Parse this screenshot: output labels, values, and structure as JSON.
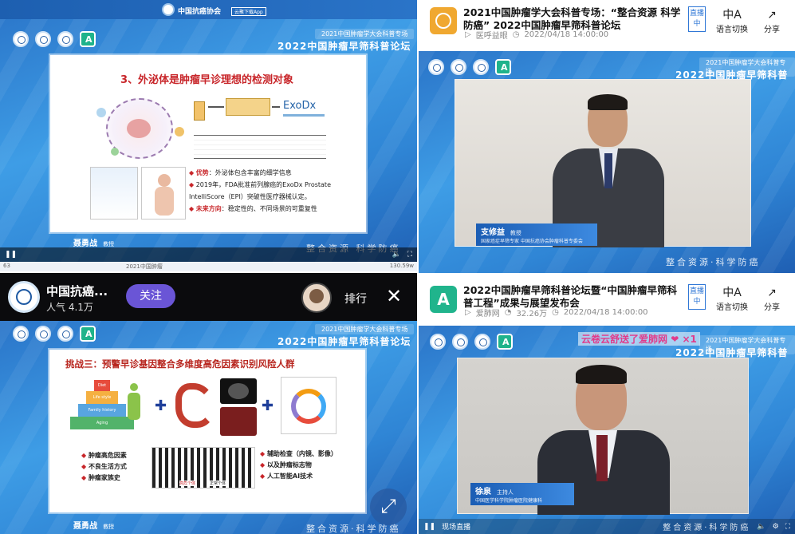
{
  "q1": {
    "header_logo_text": "中国抗癌协会",
    "header_tag": "云聚下载App",
    "forum_sub": "2021中国肿瘤学大会科普专场",
    "forum_title": "2022中国肿瘤早筛科普论坛",
    "slide_title": "3、外泌体是肿瘤早诊理想的检测对象",
    "exodx_label": "ExoDx",
    "bullets": [
      {
        "label": "优势",
        "text": "外泌体包含丰富的细学信息"
      },
      {
        "label": "",
        "text": "2019年，FDA批准前列腺癌的ExoDx Prostate IntelliScore（EPI）突破性医疗器械认定。"
      },
      {
        "label": "未来方向",
        "text": "稳定性的、不同场景的可重复性"
      }
    ],
    "speaker_name": "聂勇战",
    "speaker_role": "教授",
    "slogan": "整合资源  科学防癌",
    "bottom_left": "63",
    "bottom_mid": "2021中国肿瘤",
    "bottom_right": "130.59w"
  },
  "q2": {
    "title": "2021中国肿瘤学大会科普专场：“整合资源 科学防癌” 2022中国肿瘤早筛科普论坛",
    "channel": "医呼益眼",
    "date": "2022/04/18 14:00:00",
    "live_label": "直播中",
    "lang_label": "语言切换",
    "share_label": "分享",
    "forum_sub": "2021中国肿瘤学大会科普专场",
    "forum_title": "2022中国肿瘤早筛科普论坛",
    "speaker_name": "支修益",
    "speaker_role": "教授",
    "speaker_org": "国家癌症早筛专家 中国抗癌协会肿瘤科普专委会",
    "slogan": "整合资源·科学防癌"
  },
  "q3": {
    "channel_name": "中国抗癌...",
    "popularity": "人气 4.1万",
    "follow_label": "关注",
    "rank_label": "排行",
    "forum_sub": "2021中国肿瘤学大会科普专场",
    "forum_title": "2022中国肿瘤早筛科普论坛",
    "slide_title": "挑战三：预警早诊基因整合多维度高危因素识别风险人群",
    "pyramid": [
      "Diet",
      "Life style",
      "Family history",
      "Aging"
    ],
    "left_list": [
      "肿瘤高危因素",
      "不良生活方式",
      "肿瘤家族史"
    ],
    "right_list": [
      "辅助检查（内镜、影像）",
      "以及肿瘤标志物",
      "人工智能AI技术"
    ],
    "crowd_labels": [
      "高危个体",
      "正常个体"
    ],
    "speaker_name": "聂勇战",
    "speaker_role": "教授",
    "slogan": "整合资源·科学防癌"
  },
  "q4": {
    "title": "2022中国肿瘤早筛科普论坛暨“中国肿瘤早筛科普工程”成果与展望发布会",
    "channel": "爱肺网",
    "views": "32.26万",
    "date": "2022/04/18 14:00:00",
    "live_label": "直播中",
    "lang_label": "语言切换",
    "share_label": "分享",
    "gift_text": "云卷云舒送了爱肺网",
    "gift_count": "×1",
    "forum_sub": "2021中国肿瘤学大会科普专场",
    "forum_title": "2022中国肿瘤早筛科普论坛",
    "speaker_name": "徐泉",
    "speaker_role": "主持人",
    "speaker_org": "中国医学科学院肿瘤医院健康科",
    "live_link": "现场直播",
    "slogan": "整合资源·科学防癌"
  }
}
